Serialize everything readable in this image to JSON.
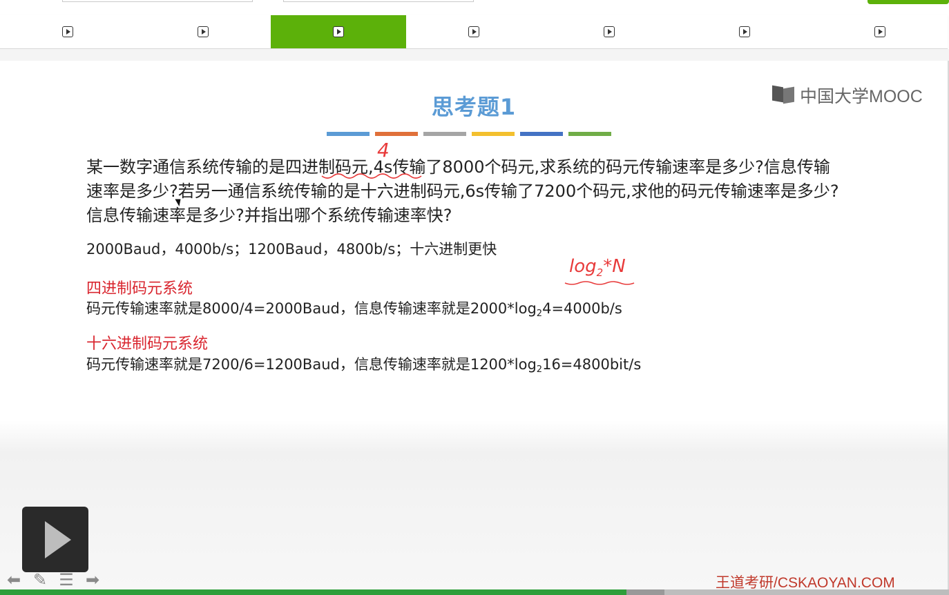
{
  "tabs": [
    {
      "icon": "play-icon",
      "active": false
    },
    {
      "icon": "play-icon",
      "active": false
    },
    {
      "icon": "play-icon",
      "active": true
    },
    {
      "icon": "play-icon",
      "active": false
    },
    {
      "icon": "play-icon",
      "active": false
    },
    {
      "icon": "play-icon",
      "active": false
    },
    {
      "icon": "play-icon",
      "active": false
    }
  ],
  "slide": {
    "title": "思考题1",
    "logo_text": "中国大学MOOC",
    "color_bars": [
      "#5b9bd5",
      "#e0703a",
      "#a5a5a5",
      "#f3c02e",
      "#4472c4",
      "#70ad47"
    ],
    "question": {
      "part1": "某一数字通信系统传输的是",
      "underlined": "四进制码元",
      "part2": ",4s传输了8000个码元,求系统的码元传输速率是多少?信息传输速率是多少?若另一通信系统传输的是十六进制码元,6s传输了7200个码元,求他的码元传输速率是多少?信息传输速率是多少?并指出哪个系统传输速率快?"
    },
    "answer": "2000Baud，4000b/s；1200Baud，4800b/s；十六进制更快",
    "section1": {
      "title": "四进制码元系统",
      "line_a": "码元传输速率就是8000/4=2000Baud，信息传输速率就是2000*log",
      "sub": "2",
      "line_b": "4=4000b/s"
    },
    "section2": {
      "title": "十六进制码元系统",
      "line_a": "码元传输速率就是7200/6=1200Baud，信息传输速率就是1200*log",
      "sub": "2",
      "line_b": "16=4800bit/s"
    },
    "annotations": {
      "four": "4",
      "log": "log",
      "log_sub": "2",
      "log_tail": "*N"
    }
  },
  "footer": {
    "watermark": "王道考研/CSKAOYAN.COM"
  },
  "player": {
    "progress": 0.66,
    "buffered_end": 0.7
  },
  "colors": {
    "accent": "#5cb10a",
    "title": "#5b9bd5",
    "section": "#d9262f",
    "annotation": "#e83a3a"
  }
}
